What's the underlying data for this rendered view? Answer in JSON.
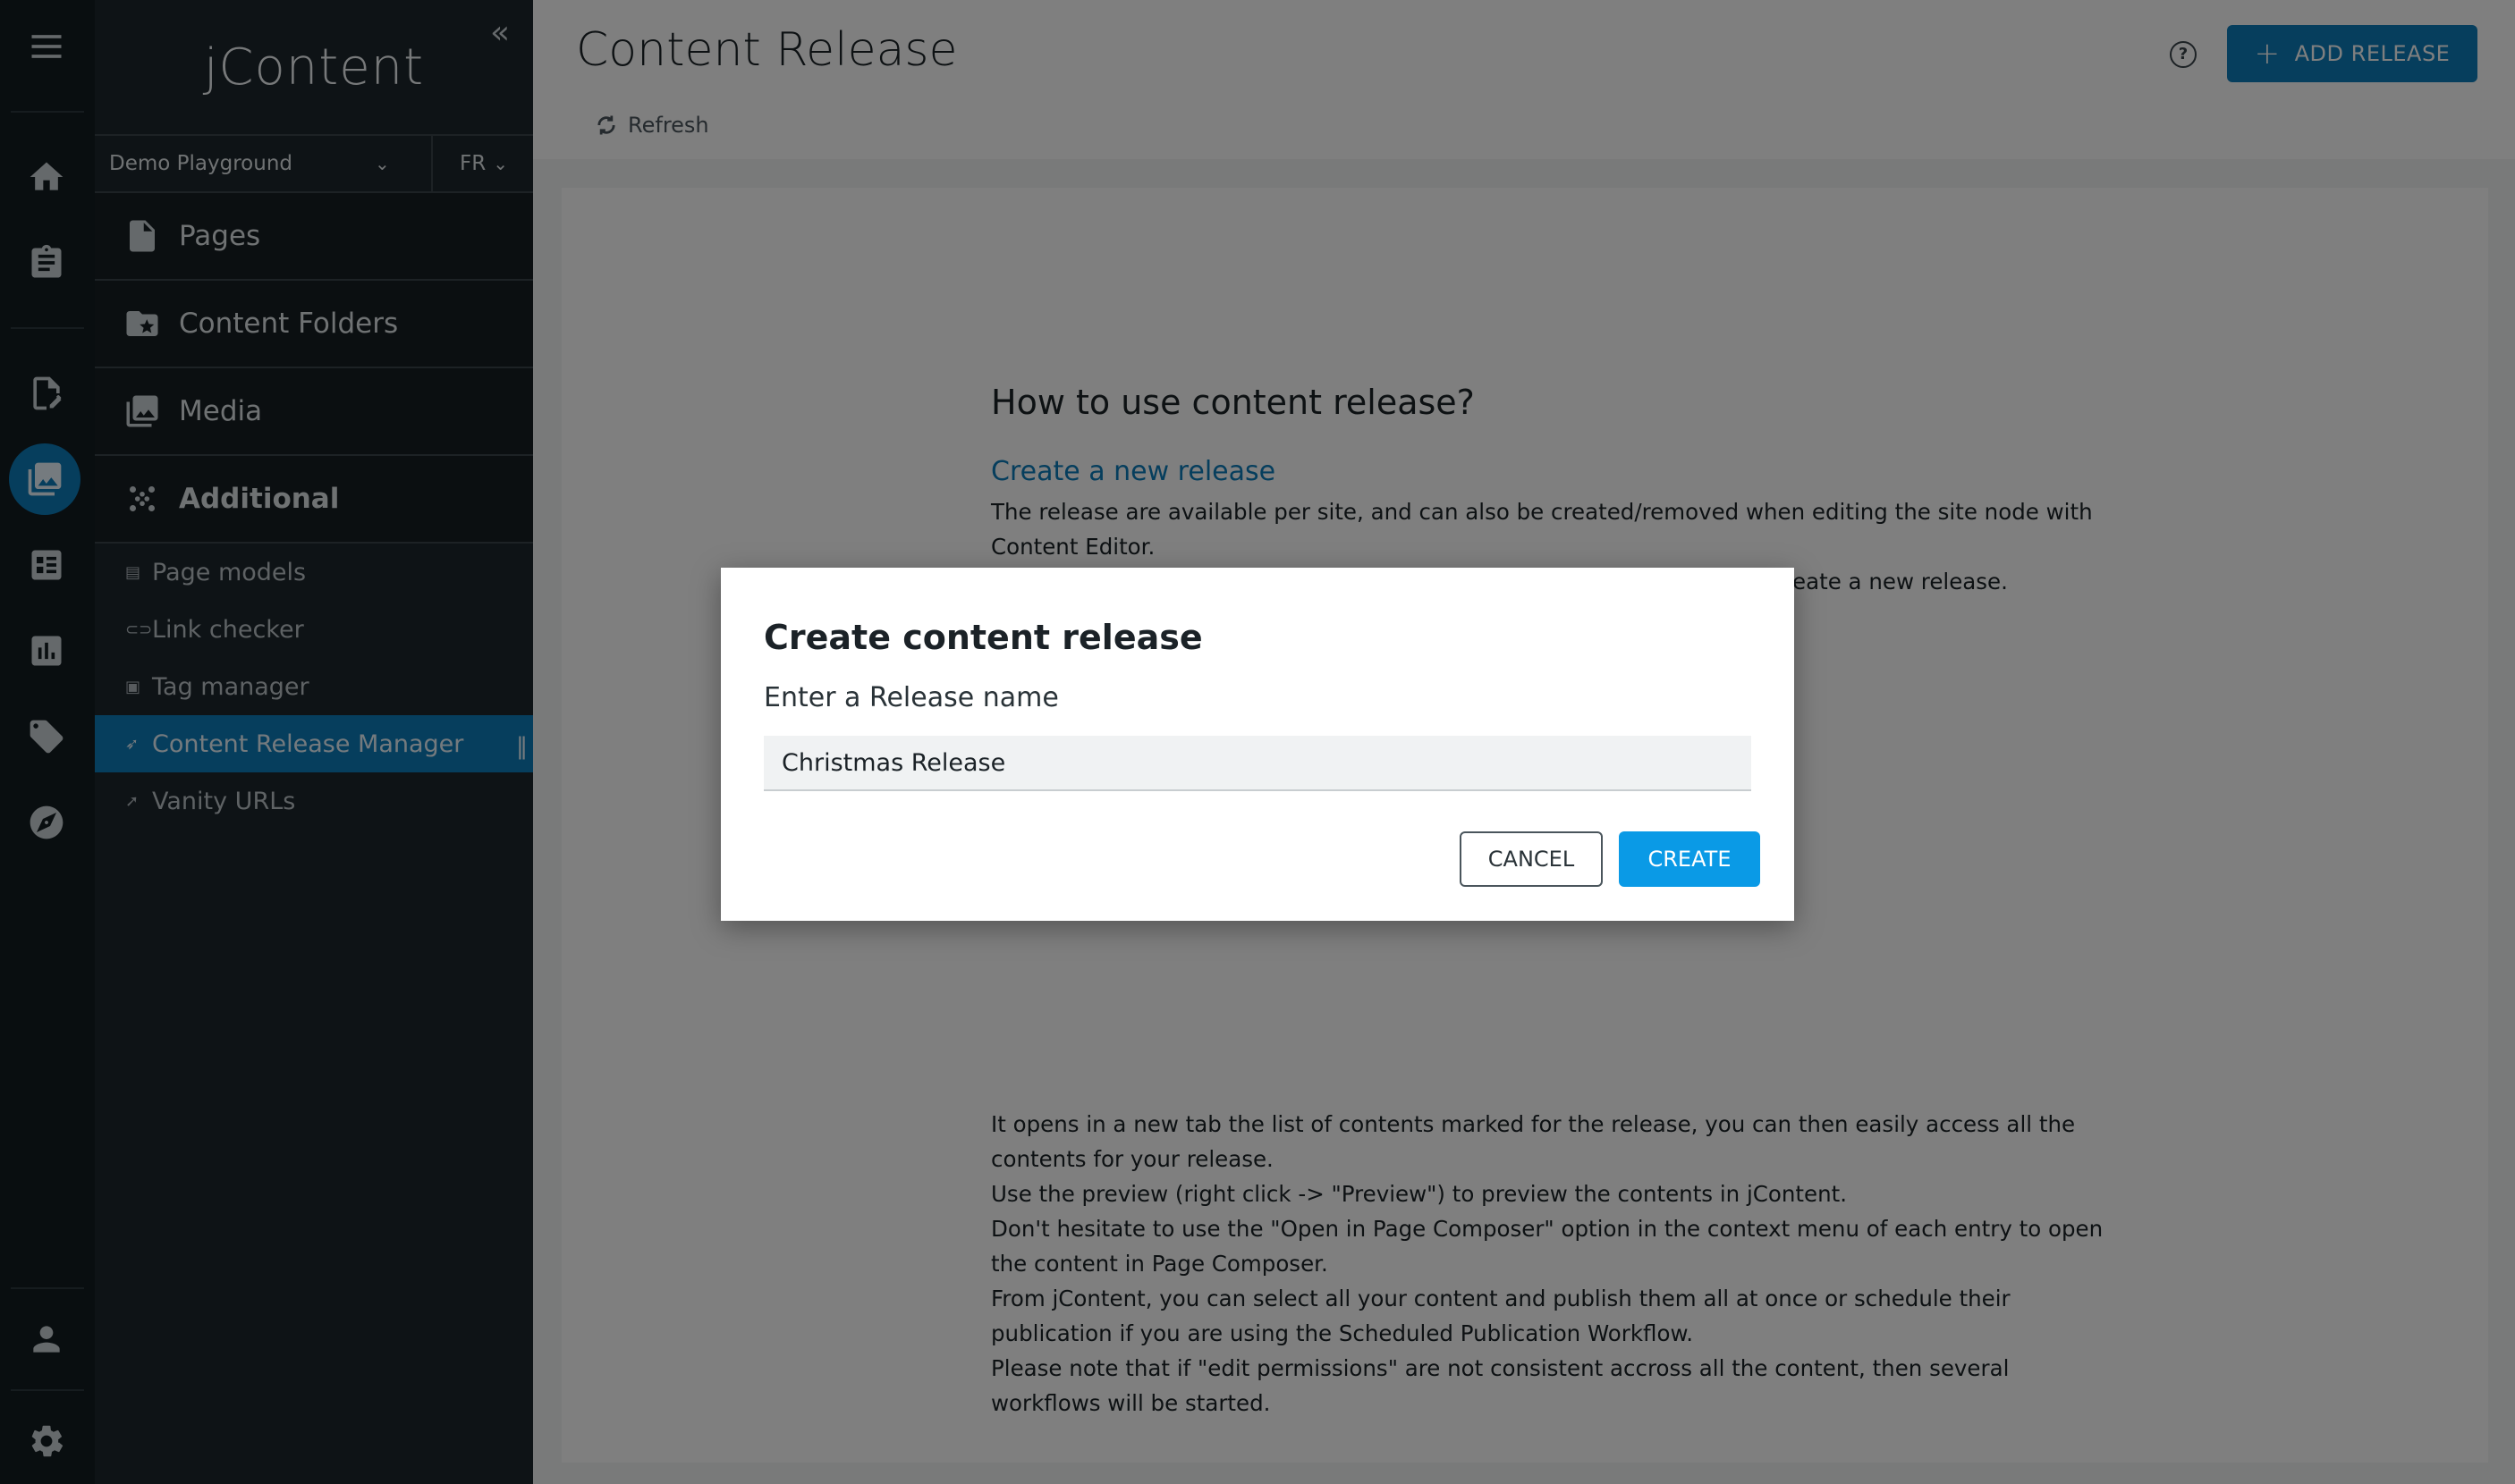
{
  "brand": {
    "name": "jContent",
    "collapse_glyph": "«"
  },
  "site_selector": {
    "value": "Demo Playground"
  },
  "language_selector": {
    "value": "FR"
  },
  "nav": {
    "items": [
      {
        "label": "Pages",
        "icon": "page-icon"
      },
      {
        "label": "Content Folders",
        "icon": "folder-star-icon"
      },
      {
        "label": "Media",
        "icon": "image-gallery-icon"
      },
      {
        "label": "Additional",
        "icon": "dots-grid-icon"
      }
    ],
    "subitems": [
      {
        "label": "Page models",
        "icon": "table-icon"
      },
      {
        "label": "Link checker",
        "icon": "link-icon"
      },
      {
        "label": "Tag manager",
        "icon": "tag-book-icon"
      },
      {
        "label": "Content Release Manager",
        "icon": "rocket-icon",
        "active": true
      },
      {
        "label": "Vanity URLs",
        "icon": "arrow-icon"
      }
    ]
  },
  "rail": {
    "icons": [
      "menu-icon",
      "home-icon",
      "clipboard-icon",
      "page-edit-icon",
      "media-icon",
      "form-icon",
      "chart-icon",
      "tag-icon",
      "compass-icon",
      "user-icon",
      "settings-icon"
    ],
    "active": "media-icon"
  },
  "header": {
    "title": "Content Release",
    "refresh_label": "Refresh",
    "help_glyph": "?",
    "add_button_label": "ADD RELEASE"
  },
  "doc": {
    "heading": "How to use content release?",
    "subheading": "Create a new release",
    "intro": "The release are available per site, and can also be created/removed when editing the site node with Content Editor.",
    "partial_line": "eate a new release.",
    "paragraphs": [
      "It opens in a new tab the list of contents marked for the release, you can then easily access all the contents for your release.",
      "Use the preview (right click -> \"Preview\") to preview the contents in jContent.",
      "Don't hesitate to use the \"Open in Page Composer\" option in the context menu of each entry to open the content in Page Composer.",
      "From jContent, you can select all your content and publish them all at once or schedule their publication if you are using the Scheduled Publication Workflow.",
      "Please note that if \"edit permissions\" are not consistent accross all the content, then several workflows will be started."
    ]
  },
  "dialog": {
    "title": "Create content release",
    "field_label": "Enter a Release name",
    "field_value": "Christmas Release",
    "cancel_label": "CANCEL",
    "create_label": "CREATE"
  },
  "colors": {
    "accent": "#0d7cba",
    "create_button": "#0a9ae6",
    "rail_bg": "#131c21",
    "nav_bg": "#1d262c"
  }
}
